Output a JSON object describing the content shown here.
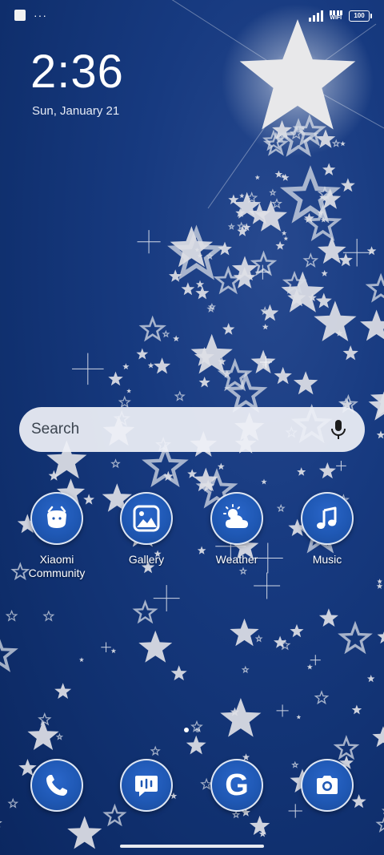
{
  "status_bar": {
    "left_icons": [
      "notification-square-icon",
      "more-dots-icon"
    ],
    "more_dots": "···",
    "wifi_label": "WIFI",
    "battery": "100"
  },
  "lock": {
    "time": "2:36",
    "date": "Sun, January 21"
  },
  "search": {
    "placeholder": "Search",
    "icon": "mic-icon"
  },
  "apps": [
    {
      "label": "Xiaomi\nCommunity",
      "icon": "xiaomi-community-icon"
    },
    {
      "label": "Gallery",
      "icon": "gallery-icon"
    },
    {
      "label": "Weather",
      "icon": "weather-icon"
    },
    {
      "label": "Music",
      "icon": "music-icon"
    }
  ],
  "page_indicator": {
    "count": 2,
    "active_index": 0
  },
  "dock": [
    {
      "name": "phone",
      "icon": "phone-icon"
    },
    {
      "name": "messages",
      "icon": "messages-icon"
    },
    {
      "name": "google",
      "icon": "google-icon",
      "letter": "G"
    },
    {
      "name": "camera",
      "icon": "camera-icon"
    }
  ],
  "colors": {
    "background": "#173a80",
    "app_icon": "#1f58b4",
    "star": "#dcdcdc"
  }
}
